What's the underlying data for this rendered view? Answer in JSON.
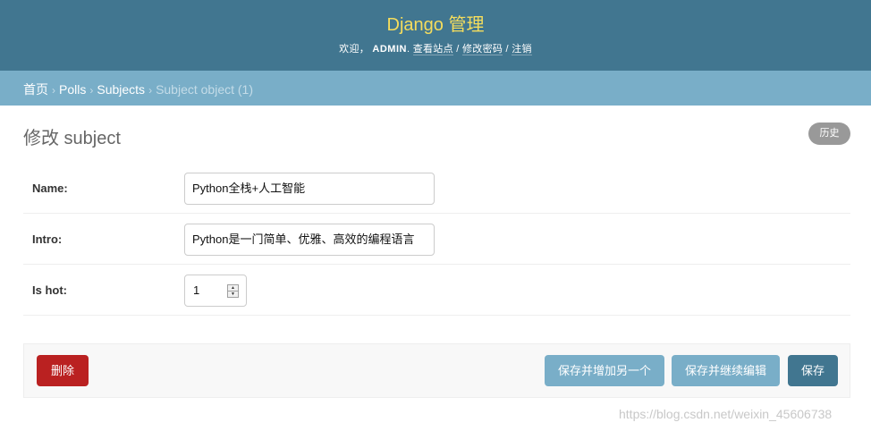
{
  "header": {
    "site_name": "Django 管理",
    "welcome": "欢迎，",
    "username": "admin",
    "username_suffix": ".",
    "view_site": "查看站点",
    "change_password": "修改密码",
    "logout": "注销",
    "separator": "/"
  },
  "breadcrumbs": {
    "home": "首页",
    "app": "Polls",
    "model": "Subjects",
    "current": "Subject object (1)",
    "separator": "›"
  },
  "page": {
    "title": "修改 subject",
    "history_label": "历史"
  },
  "form": {
    "name": {
      "label": "Name:",
      "value": "Python全栈+人工智能"
    },
    "intro": {
      "label": "Intro:",
      "value": "Python是一门简单、优雅、高效的编程语言"
    },
    "is_hot": {
      "label": "Is hot:",
      "value": "1"
    }
  },
  "submit_row": {
    "delete_label": "删除",
    "save_add_label": "保存并增加另一个",
    "save_continue_label": "保存并继续编辑",
    "save_label": "保存"
  },
  "watermark": "https://blog.csdn.net/weixin_45606738",
  "colors": {
    "header_bg": "#417690",
    "site_name": "#f5dd5d",
    "breadcrumbs_bg": "#79aec8",
    "delete_bg": "#ba2121",
    "secondary_button_bg": "#79aec8",
    "primary_button_bg": "#417690",
    "history_bg": "#999999"
  }
}
